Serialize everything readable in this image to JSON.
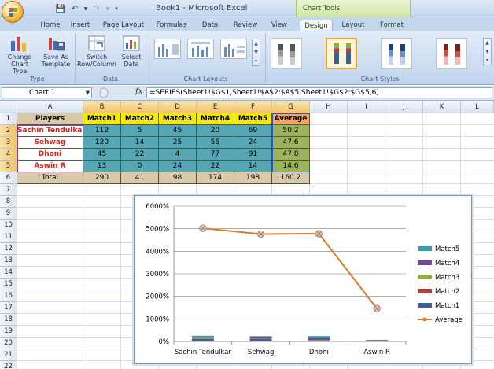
{
  "window": {
    "title": "Book1 - Microsoft Excel",
    "context_tab_group": "Chart Tools"
  },
  "tabs": [
    "Home",
    "Insert",
    "Page Layout",
    "Formulas",
    "Data",
    "Review",
    "View",
    "Design",
    "Layout",
    "Format"
  ],
  "active_tab": "Design",
  "ribbon": {
    "type_group": {
      "label": "Type",
      "change_chart_type": [
        "Change",
        "Chart Type"
      ],
      "save_as_template": [
        "Save As",
        "Template"
      ]
    },
    "data_group": {
      "label": "Data",
      "switch_row_column": [
        "Switch",
        "Row/Column"
      ],
      "select_data": [
        "Select",
        "Data"
      ]
    },
    "layouts_group": {
      "label": "Chart Layouts"
    },
    "styles_group": {
      "label": "Chart Styles"
    }
  },
  "formula_bar": {
    "name_box": "Chart 1",
    "fx": "fx",
    "formula": "=SERIES(Sheet1!$G$1,Sheet1!$A$2:$A$5,Sheet1!$G$2:$G$5,6)"
  },
  "columns": [
    "A",
    "B",
    "C",
    "D",
    "E",
    "F",
    "G",
    "H",
    "I",
    "J",
    "K",
    "L"
  ],
  "rows": [
    "1",
    "2",
    "3",
    "4",
    "5",
    "6",
    "7",
    "8",
    "9",
    "10",
    "11",
    "12",
    "13",
    "14",
    "15",
    "16",
    "17",
    "18",
    "19",
    "20",
    "21",
    "22",
    "23"
  ],
  "table": {
    "header": [
      "Players",
      "Match1",
      "Match2",
      "Match3",
      "Match4",
      "Match5",
      "Average"
    ],
    "rows": [
      [
        "Sachin Tendulkar",
        "112",
        "5",
        "45",
        "20",
        "69",
        "50.2"
      ],
      [
        "Sehwag",
        "120",
        "14",
        "25",
        "55",
        "24",
        "47.6"
      ],
      [
        "Dhoni",
        "45",
        "22",
        "4",
        "77",
        "91",
        "47.8"
      ],
      [
        "Aswin R",
        "13",
        "0",
        "24",
        "22",
        "14",
        "14.6"
      ]
    ],
    "total": [
      "Total",
      "290",
      "41",
      "98",
      "174",
      "198",
      "160.2"
    ]
  },
  "colors": {
    "header_yellow": "#f5e80f",
    "header_orange": "#f5a55c",
    "player_text": "#e0201a",
    "data_teal": "#56a7b5",
    "average_green": "#9bb35a",
    "total_tan": "#d8caa9",
    "average_line": "#e0782a"
  },
  "chart_data": {
    "type": "line",
    "categories": [
      "Sachin Tendulkar",
      "Sehwag",
      "Dhoni",
      "Aswin R"
    ],
    "y_ticks": [
      "0%",
      "1000%",
      "2000%",
      "3000%",
      "4000%",
      "5000%",
      "6000%"
    ],
    "ylim": [
      0,
      6000
    ],
    "series": [
      {
        "name": "Match1",
        "type": "stacked-bar-percent",
        "values": [
          112,
          120,
          45,
          13
        ],
        "color": "#3c5f9a"
      },
      {
        "name": "Match2",
        "type": "stacked-bar-percent",
        "values": [
          5,
          14,
          22,
          0
        ],
        "color": "#b43e3b"
      },
      {
        "name": "Match3",
        "type": "stacked-bar-percent",
        "values": [
          45,
          25,
          4,
          24
        ],
        "color": "#8fae4a"
      },
      {
        "name": "Match4",
        "type": "stacked-bar-percent",
        "values": [
          20,
          55,
          77,
          22
        ],
        "color": "#6b4b91"
      },
      {
        "name": "Match5",
        "type": "stacked-bar-percent",
        "values": [
          69,
          24,
          91,
          14
        ],
        "color": "#3c9ab0"
      },
      {
        "name": "Average",
        "type": "line",
        "values": [
          5020,
          4760,
          4780,
          1460
        ],
        "color": "#e0782a"
      }
    ],
    "legend_order": [
      "Match5",
      "Match4",
      "Match3",
      "Match2",
      "Match1",
      "Average"
    ],
    "legend": "right",
    "grid": true
  }
}
